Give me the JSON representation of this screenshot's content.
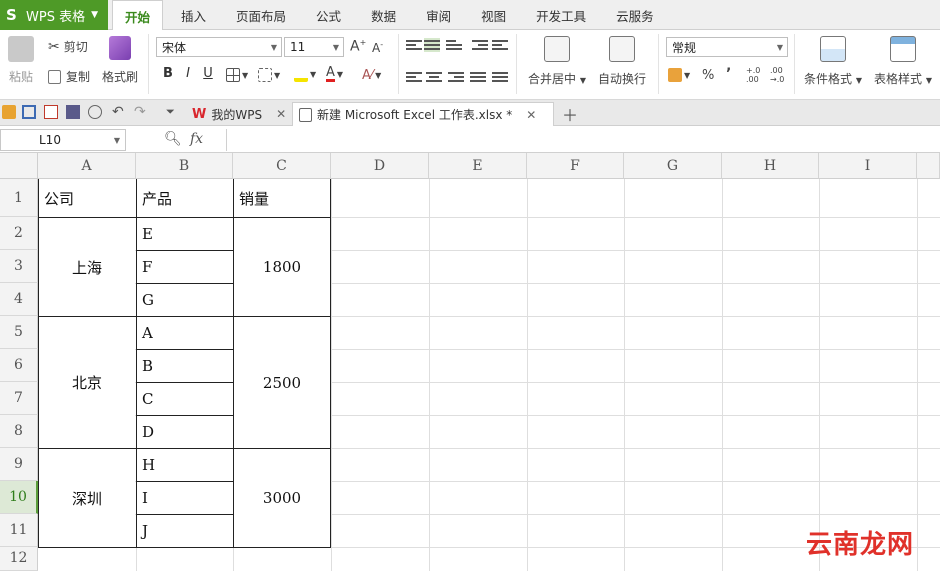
{
  "app": {
    "name": "WPS 表格",
    "logo": "S"
  },
  "menu_tabs": [
    "开始",
    "插入",
    "页面布局",
    "公式",
    "数据",
    "审阅",
    "视图",
    "开发工具",
    "云服务"
  ],
  "ribbon": {
    "paste": "粘贴",
    "cut": "剪切",
    "copy": "复制",
    "format_painter": "格式刷",
    "font_name": "宋体",
    "font_size": "11",
    "bold": "B",
    "italic": "I",
    "underline": "U",
    "merge_center": "合并居中",
    "wrap_text": "自动换行",
    "number_format": "常规",
    "percent": "%",
    "comma": "’",
    "inc_decimal": "+.0\n.00",
    "dec_decimal": ".00\n→.0",
    "conditional_format": "条件格式",
    "table_style": "表格样式"
  },
  "doc_tabs": [
    {
      "label": "我的WPS"
    },
    {
      "label": "新建 Microsoft Excel 工作表.xlsx *"
    }
  ],
  "formula_bar": {
    "name_box": "L10",
    "fx": "fx"
  },
  "columns": [
    "A",
    "B",
    "C",
    "D",
    "E",
    "F",
    "G",
    "H",
    "I"
  ],
  "rows": [
    "1",
    "2",
    "3",
    "4",
    "5",
    "6",
    "7",
    "8",
    "9",
    "10",
    "11",
    "12"
  ],
  "selected_row": "10",
  "table": {
    "headers": [
      "公司",
      "产品",
      "销量"
    ],
    "groups": [
      {
        "company": "上海",
        "products": [
          "E",
          "F",
          "G"
        ],
        "sales": "1800"
      },
      {
        "company": "北京",
        "products": [
          "A",
          "B",
          "C",
          "D"
        ],
        "sales": "2500"
      },
      {
        "company": "深圳",
        "products": [
          "H",
          "I",
          "J"
        ],
        "sales": "3000"
      }
    ]
  },
  "watermark": "云南龙网",
  "colors": {
    "accent": "#4e9a27",
    "active_tab": "#3b8a1d",
    "watermark": "#e0312a"
  }
}
